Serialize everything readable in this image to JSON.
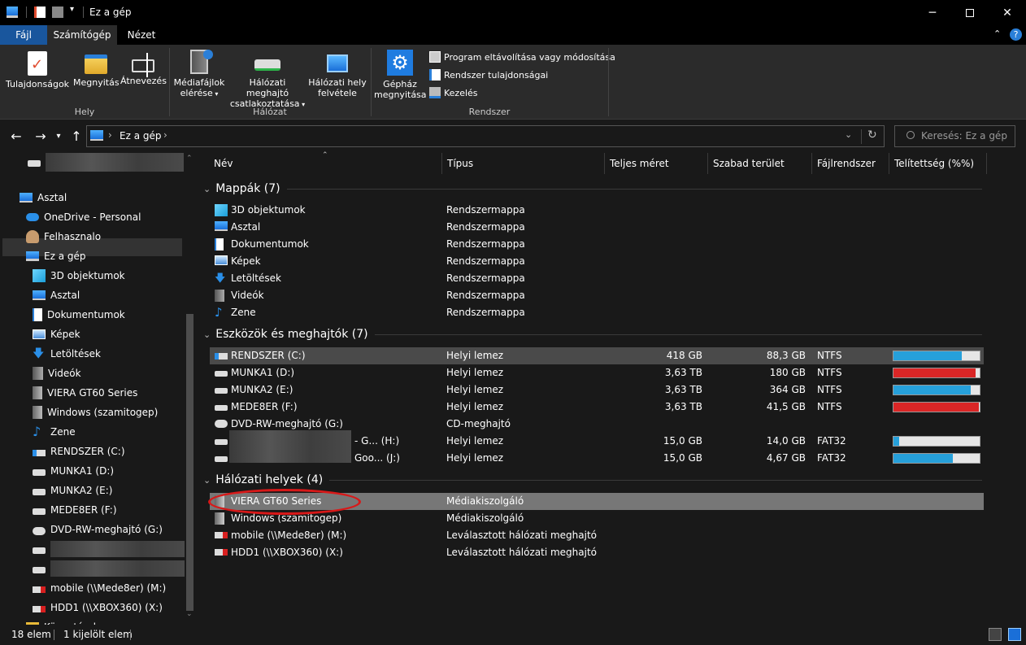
{
  "window": {
    "title": "Ez a gép"
  },
  "tabs": [
    {
      "label": "Fájl"
    },
    {
      "label": "Számítógép"
    },
    {
      "label": "Nézet"
    }
  ],
  "ribbon": {
    "groups": [
      {
        "label": "Hely"
      },
      {
        "label": "Hálózat"
      },
      {
        "label": "Rendszer"
      }
    ],
    "buttons": {
      "properties": "Tulajdonságok",
      "open": "Megnyitás",
      "rename": "Átnevezés",
      "media_line1": "Médiafájlok",
      "media_line2": "elérése",
      "mapdrive_line1": "Hálózati meghajtó",
      "mapdrive_line2": "csatlakoztatása",
      "addloc_line1": "Hálózati hely",
      "addloc_line2": "felvétele",
      "settings_line1": "Gépház",
      "settings_line2": "megnyitása",
      "uninstall": "Program eltávolítása vagy módosítása",
      "sysprops": "Rendszer tulajdonságai",
      "manage": "Kezelés"
    }
  },
  "address": {
    "path": "Ez a gép",
    "search_placeholder": "Keresés: Ez a gép"
  },
  "sidebar": {
    "items": [
      {
        "label": "",
        "icon": "drive-icon"
      },
      {
        "label": "Asztal",
        "icon": "desktop-icon"
      },
      {
        "label": "OneDrive - Personal",
        "icon": "cloud-icon"
      },
      {
        "label": "Felhasznalo",
        "icon": "user-icon"
      },
      {
        "label": "Ez a gép",
        "icon": "computer-icon"
      },
      {
        "label": "3D objektumok",
        "icon": "cube-icon"
      },
      {
        "label": "Asztal",
        "icon": "desktop-icon"
      },
      {
        "label": "Dokumentumok",
        "icon": "document-icon"
      },
      {
        "label": "Képek",
        "icon": "pictures-icon"
      },
      {
        "label": "Letöltések",
        "icon": "download-icon"
      },
      {
        "label": "Videók",
        "icon": "video-icon"
      },
      {
        "label": "VIERA GT60 Series",
        "icon": "media-server-icon"
      },
      {
        "label": "Windows (szamitogep)",
        "icon": "media-server-icon"
      },
      {
        "label": "Zene",
        "icon": "music-icon"
      },
      {
        "label": "RENDSZER (C:)",
        "icon": "system-drive-icon"
      },
      {
        "label": "MUNKA1 (D:)",
        "icon": "drive-icon"
      },
      {
        "label": "MUNKA2 (E:)",
        "icon": "drive-icon"
      },
      {
        "label": "MEDE8ER (F:)",
        "icon": "drive-icon"
      },
      {
        "label": "DVD-RW-meghajtó (G:)",
        "icon": "dvd-icon"
      },
      {
        "label": "",
        "icon": "drive-icon"
      },
      {
        "label": "",
        "icon": "drive-icon"
      },
      {
        "label": "mobile (\\\\Mede8er) (M:)",
        "icon": "network-drive-disconnected-icon"
      },
      {
        "label": "HDD1 (\\\\XBOX360) (X:)",
        "icon": "network-drive-disconnected-icon"
      },
      {
        "label": "Könyvtárak",
        "icon": "library-icon"
      }
    ]
  },
  "columns": [
    {
      "label": "Név"
    },
    {
      "label": "Típus"
    },
    {
      "label": "Teljes méret"
    },
    {
      "label": "Szabad terület"
    },
    {
      "label": "Fájlrendszer"
    },
    {
      "label": "Telítettség (%%)"
    }
  ],
  "groups": {
    "folders": {
      "title": "Mappák (7)",
      "rows": [
        {
          "name": "3D objektumok",
          "type": "Rendszermappa",
          "icon": "cube-icon"
        },
        {
          "name": "Asztal",
          "type": "Rendszermappa",
          "icon": "desktop-icon"
        },
        {
          "name": "Dokumentumok",
          "type": "Rendszermappa",
          "icon": "document-icon"
        },
        {
          "name": "Képek",
          "type": "Rendszermappa",
          "icon": "pictures-icon"
        },
        {
          "name": "Letöltések",
          "type": "Rendszermappa",
          "icon": "download-icon"
        },
        {
          "name": "Videók",
          "type": "Rendszermappa",
          "icon": "video-icon"
        },
        {
          "name": "Zene",
          "type": "Rendszermappa",
          "icon": "music-icon"
        }
      ]
    },
    "drives": {
      "title": "Eszközök és meghajtók (7)",
      "rows": [
        {
          "name": "RENDSZER (C:)",
          "type": "Helyi lemez",
          "total": "418 GB",
          "free": "88,3 GB",
          "fs": "NTFS",
          "used": 0.79,
          "bar_color": "#26a0da"
        },
        {
          "name": "MUNKA1 (D:)",
          "type": "Helyi lemez",
          "total": "3,63 TB",
          "free": "180 GB",
          "fs": "NTFS",
          "used": 0.95,
          "bar_color": "#da2626"
        },
        {
          "name": "MUNKA2 (E:)",
          "type": "Helyi lemez",
          "total": "3,63 TB",
          "free": "364 GB",
          "fs": "NTFS",
          "used": 0.9,
          "bar_color": "#26a0da"
        },
        {
          "name": "MEDE8ER (F:)",
          "type": "Helyi lemez",
          "total": "3,63 TB",
          "free": "41,5 GB",
          "fs": "NTFS",
          "used": 0.99,
          "bar_color": "#da2626"
        },
        {
          "name": "DVD-RW-meghajtó (G:)",
          "type": "CD-meghajtó",
          "total": "",
          "free": "",
          "fs": "",
          "used": null,
          "bar_color": ""
        },
        {
          "name": "- G... (H:)",
          "type": "Helyi lemez",
          "total": "15,0 GB",
          "free": "14,0 GB",
          "fs": "FAT32",
          "used": 0.07,
          "bar_color": "#26a0da"
        },
        {
          "name": "Goo... (J:)",
          "type": "Helyi lemez",
          "total": "15,0 GB",
          "free": "4,67 GB",
          "fs": "FAT32",
          "used": 0.69,
          "bar_color": "#26a0da"
        }
      ]
    },
    "network": {
      "title": "Hálózati helyek (4)",
      "rows": [
        {
          "name": "VIERA GT60 Series",
          "type": "Médiakiszolgáló"
        },
        {
          "name": "Windows (szamitogep)",
          "type": "Médiakiszolgáló"
        },
        {
          "name": "mobile (\\\\Mede8er) (M:)",
          "type": "Leválasztott hálózati meghajtó"
        },
        {
          "name": "HDD1 (\\\\XBOX360) (X:)",
          "type": "Leválasztott hálózati meghajtó"
        }
      ]
    }
  },
  "status": {
    "count": "18 elem",
    "selected": "1 kijelölt elem"
  }
}
